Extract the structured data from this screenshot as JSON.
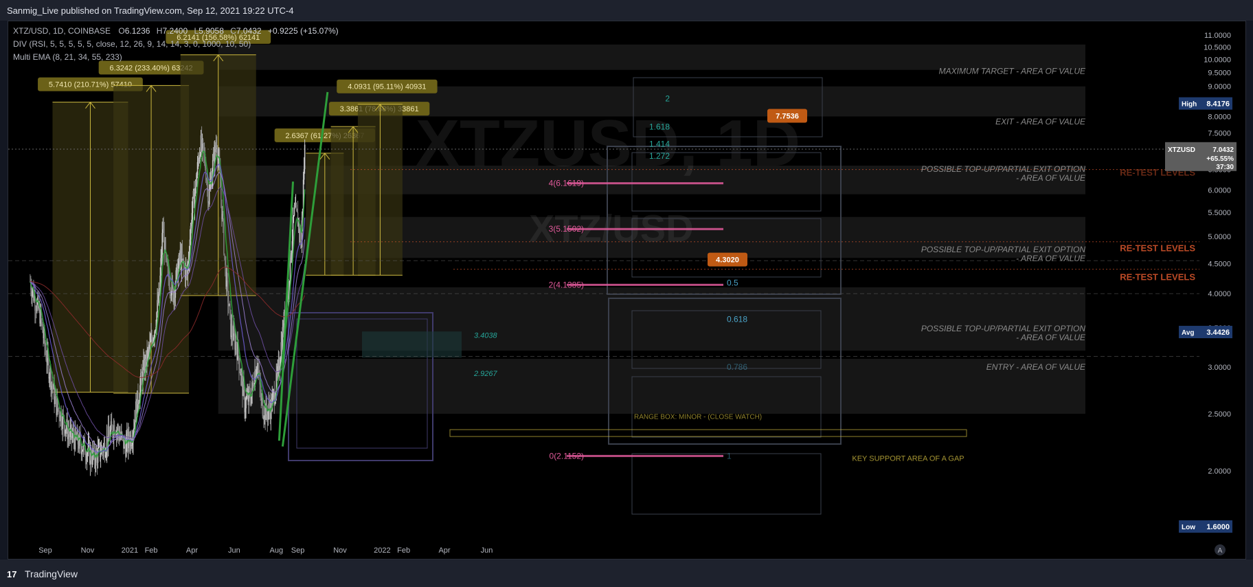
{
  "header": {
    "published": "Sanmig_Live published on TradingView.com, Sep 12, 2021 19:22 UTC-4"
  },
  "footer": {
    "logo_text": "TradingView",
    "logo_glyph": "17"
  },
  "legend": {
    "symbol": "XTZ/USD, 1D, COINBASE",
    "open_label": "O",
    "open": "6.1236",
    "high_label": "H",
    "high": "7.2400",
    "low_label": "L",
    "low": "5.9058",
    "close_label": "C",
    "close": "7.0432",
    "change": "+0.9225 (+15.07%)",
    "indicator1": "DIV (RSI, 5, 5, 5, 5, 5, close, 12, 26, 9, 14, 14, 3, 0, 1000, 10, 50)",
    "indicator2": "Multi EMA (8, 21, 34, 55, 233)"
  },
  "watermark": {
    "large": "XTZUSD, 1D",
    "small": "XTZ/USD"
  },
  "colors": {
    "background": "#000000",
    "frame": "#131722",
    "up_candle": "#c8c8c8",
    "ema8": "#2e9e3a",
    "ema21": "#6a5acd",
    "ema34": "#9a7fd0",
    "ema55": "#6b4da0",
    "ema233": "#8b2a2a",
    "measure": "#cdb93f",
    "measure_label_bg": "#6b6118",
    "fib": "#e05a9a",
    "fib_teal": "#26a69a",
    "retest": "#d0532b",
    "high_label": "#1e3a6e",
    "price_label": "#5d5d5d"
  },
  "chart_data": {
    "type": "candlestick",
    "title": "XTZ/USD, 1D, COINBASE",
    "ylim": [
      1.6,
      11.0
    ],
    "y_ticks": [
      2.0,
      2.5,
      3.0,
      3.5,
      4.0,
      4.5,
      5.0,
      5.5,
      6.0,
      6.5,
      7.0,
      7.5,
      8.0,
      8.5,
      9.0,
      9.5,
      10.0,
      10.5,
      11.0
    ],
    "y_tick_labels": [
      "2.0000",
      "2.5000",
      "3.0000",
      "3.5000",
      "4.0000",
      "4.5000",
      "5.0000",
      "5.5000",
      "6.0000",
      "6.5000",
      "7.0000",
      "7.5000",
      "8.0000",
      "8.5000",
      "9.0000",
      "9.5000",
      "10.0000",
      "10.5000",
      "11.0000"
    ],
    "x_labels": [
      {
        "label": "Sep",
        "day": 0
      },
      {
        "label": "Nov",
        "day": 61
      },
      {
        "label": "2021",
        "day": 122
      },
      {
        "label": "Feb",
        "day": 153
      },
      {
        "label": "Apr",
        "day": 212
      },
      {
        "label": "Jun",
        "day": 273
      },
      {
        "label": "Aug",
        "day": 334
      },
      {
        "label": "Sep",
        "day": 365
      },
      {
        "label": "Nov",
        "day": 426
      },
      {
        "label": "2022",
        "day": 487
      },
      {
        "label": "Feb",
        "day": 518
      },
      {
        "label": "Apr",
        "day": 577
      },
      {
        "label": "Jun",
        "day": 638
      }
    ],
    "price_path": [
      [
        -22,
        4.2
      ],
      [
        -15,
        3.9
      ],
      [
        -8,
        3.7
      ],
      [
        0,
        3.2
      ],
      [
        15,
        2.6
      ],
      [
        35,
        2.3
      ],
      [
        55,
        2.2
      ],
      [
        70,
        2.1
      ],
      [
        85,
        2.2
      ],
      [
        100,
        2.4
      ],
      [
        115,
        2.2
      ],
      [
        125,
        2.3
      ],
      [
        140,
        2.9
      ],
      [
        150,
        3.2
      ],
      [
        158,
        3.5
      ],
      [
        165,
        4.0
      ],
      [
        170,
        5.2
      ],
      [
        175,
        4.4
      ],
      [
        185,
        4.0
      ],
      [
        195,
        4.6
      ],
      [
        205,
        4.3
      ],
      [
        212,
        5.5
      ],
      [
        218,
        6.2
      ],
      [
        224,
        7.2
      ],
      [
        230,
        6.8
      ],
      [
        236,
        5.8
      ],
      [
        242,
        6.6
      ],
      [
        248,
        7.3
      ],
      [
        254,
        5.8
      ],
      [
        260,
        4.4
      ],
      [
        268,
        3.5
      ],
      [
        278,
        3.2
      ],
      [
        288,
        2.6
      ],
      [
        298,
        2.7
      ],
      [
        306,
        3.1
      ],
      [
        312,
        2.6
      ],
      [
        320,
        2.5
      ],
      [
        328,
        2.6
      ],
      [
        336,
        2.9
      ],
      [
        344,
        3.5
      ],
      [
        352,
        4.2
      ],
      [
        360,
        5.5
      ],
      [
        366,
        5.3
      ],
      [
        370,
        4.8
      ],
      [
        375,
        7.04
      ]
    ],
    "high_marker": 8.4176,
    "low_marker": 1.6,
    "avg_marker": 3.4426,
    "last_price": 7.0432,
    "last_change": "+65.55%",
    "countdown": "37:30",
    "markers": {
      "high_label": "High",
      "high_value": "8.4176",
      "low_label": "Low",
      "low_value": "1.6000",
      "avg_label": "Avg",
      "avg_value": "3.4426",
      "symbol_tag": "XTZUSD",
      "last_value": "7.0432",
      "last_change": "+65.55%",
      "countdown": "37:30"
    },
    "measurements": [
      {
        "label": "5.7410 (210.71%) 57410",
        "from": 2.72,
        "to": 8.46,
        "day": 65
      },
      {
        "label": "6.3242 (233.40%) 63242",
        "from": 2.71,
        "to": 9.03,
        "day": 153
      },
      {
        "label": "6.2141 (156.58%) 62141",
        "from": 3.97,
        "to": 10.18,
        "day": 250
      },
      {
        "label": "2.6367 (61.27%) 26367",
        "from": 4.3,
        "to": 6.93,
        "day": 404
      },
      {
        "label": "3.3861 (78.68%) 33861",
        "from": 4.3,
        "to": 7.69,
        "day": 445
      },
      {
        "label": "4.0931 (95.11%) 40931",
        "from": 4.3,
        "to": 8.39,
        "day": 484
      }
    ],
    "fib_levels": [
      {
        "label": "4(6.1619)",
        "value": 6.16
      },
      {
        "label": "3(5.1502)",
        "value": 5.15
      },
      {
        "label": "2(4.1385)",
        "value": 4.14
      },
      {
        "label": "0(2.1152)",
        "value": 2.12
      }
    ],
    "fib_ext_labels": [
      {
        "label": "2",
        "value": 8.58
      },
      {
        "label": "1.618",
        "value": 7.68
      },
      {
        "label": "1.414",
        "value": 7.18
      },
      {
        "label": "1.272",
        "value": 6.85
      },
      {
        "label": "0.5",
        "value": 4.17
      },
      {
        "label": "0.618",
        "value": 3.62
      },
      {
        "label": "0.786",
        "value": 3.0
      },
      {
        "label": "1",
        "value": 2.12
      }
    ],
    "level_tags": [
      {
        "label": "7.7536",
        "value": 8.02
      },
      {
        "label": "4.3020",
        "value": 4.57
      }
    ],
    "side_labels": [
      {
        "label": "3.4038",
        "value": 3.4
      },
      {
        "label": "2.9267",
        "value": 2.93
      }
    ],
    "zones": [
      {
        "label": "MAXIMUM TARGET - AREA OF VALUE",
        "label_value": 9.45
      },
      {
        "label": "EXIT - AREA OF VALUE",
        "label_value": 7.76
      },
      {
        "label": "POSSIBLE TOP-UP/PARTIAL EXIT OPTION",
        "sub": "- AREA OF VALUE",
        "label_value": 6.44
      },
      {
        "label": "POSSIBLE TOP-UP/PARTIAL EXIT OPTION",
        "sub": "- AREA OF VALUE",
        "label_value": 4.7
      },
      {
        "label": "POSSIBLE TOP-UP/PARTIAL EXIT OPTION",
        "sub": "- AREA OF VALUE",
        "label_value": 3.45
      },
      {
        "label": "ENTRY - AREA OF VALUE",
        "label_value": 2.97
      }
    ],
    "retest_labels": [
      {
        "label": "RE-TEST LEVELS",
        "value": 6.35
      },
      {
        "label": "RE-TEST LEVELS",
        "value": 4.72
      },
      {
        "label": "RE-TEST LEVELS",
        "value": 4.22
      }
    ],
    "range_box_label": "RANGE BOX: MINOR - (CLOSE WATCH)",
    "support_label": "KEY SUPPORT AREA OF A GAP"
  }
}
